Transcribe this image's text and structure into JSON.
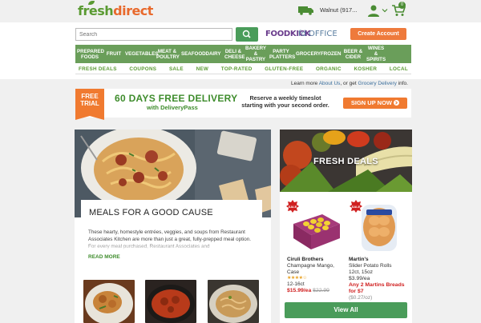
{
  "header": {
    "logo_fresh": "fresh",
    "logo_direct": "direct",
    "zip_label": "Walnut (917...",
    "cart_count": "0"
  },
  "search": {
    "placeholder": "Search"
  },
  "partners": {
    "foodkick": "FOODKICK",
    "office": "fd OFFICE"
  },
  "account": {
    "create_label": "Create Account"
  },
  "categories": [
    "PREPARED FOODS",
    "FRUIT",
    "VEGETABLES",
    "MEAT & POULTRY",
    "SEAFOOD",
    "DAIRY",
    "DELI & CHEESE",
    "BAKERY & PASTRY",
    "PARTY PLATTERS",
    "GROCERY",
    "FROZEN",
    "BEER & CIDER",
    "WINES & SPIRITS"
  ],
  "subnav": [
    "FRESH DEALS",
    "COUPONS",
    "SALE",
    "NEW",
    "TOP-RATED",
    "GLUTEN-FREE",
    "ORGANIC",
    "KOSHER",
    "LOCAL"
  ],
  "learn": {
    "prefix": "Learn more ",
    "about": "About Us",
    "middle": ", or get ",
    "grocery": "Grocery Delivery",
    "suffix": " info."
  },
  "banner": {
    "badge_line1": "FREE",
    "badge_line2": "TRIAL",
    "headline": "60 DAYS FREE DELIVERY",
    "subline": "with DeliveryPass",
    "reserve_line1": "Reserve a weekly timeslot",
    "reserve_line2": "starting with your second order.",
    "cta": "SIGN UP NOW"
  },
  "meals": {
    "title": "MEALS FOR A GOOD CAUSE",
    "body": "These hearty, homestyle entrées, veggies, and soups from Restaurant Associates Kitchen are more than just a great, fully-prepped meal option. For every meal purchased, Restaurant Associates and",
    "read_more": "READ MORE"
  },
  "fresh_deals": {
    "title": "FRESH DEALS",
    "view_all": "View All",
    "products": [
      {
        "brand": "Ciruli Brothers",
        "name": "Champagne Mango,",
        "name2": "Case",
        "size": "12-16ct",
        "rating": 4,
        "stars": "★★★★☆",
        "price": "$15.99/ea",
        "was_price": "$22.99",
        "badge": "SALE"
      },
      {
        "brand": "Martin's",
        "name": "Slider Potato Rolls",
        "size": "12ct, 15oz",
        "price": "$3.99/ea",
        "promo": "Any 2 Martins Breads for $7",
        "unit_price": "($0.27/oz)",
        "badge": "SALE"
      }
    ]
  },
  "colors": {
    "brand_green": "#5a9a32",
    "brand_orange": "#e8692c",
    "nav_green": "#6a9e5a",
    "button_green": "#4a9c5a",
    "cta_orange": "#f07a30",
    "sale_red": "#d02020"
  }
}
